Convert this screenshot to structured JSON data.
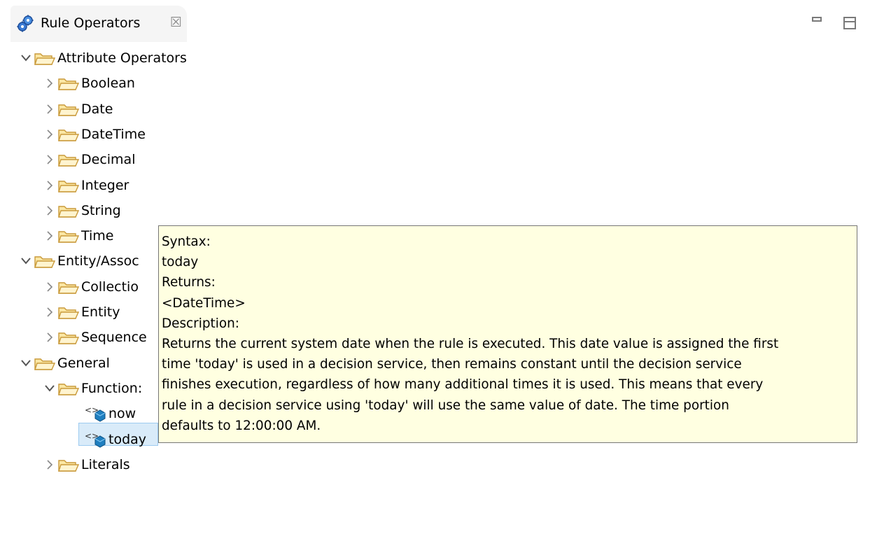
{
  "tab": {
    "title": "Rule Operators",
    "icon": "rule-operators-gears-icon",
    "close_glyph": "☒"
  },
  "tree": [
    {
      "id": "attribute-operators",
      "label": "Attribute Operators",
      "level": 0,
      "expanded": true,
      "kind": "folder"
    },
    {
      "id": "boolean",
      "label": "Boolean",
      "level": 1,
      "expanded": false,
      "kind": "folder"
    },
    {
      "id": "date",
      "label": "Date",
      "level": 1,
      "expanded": false,
      "kind": "folder"
    },
    {
      "id": "datetime",
      "label": "DateTime",
      "level": 1,
      "expanded": false,
      "kind": "folder"
    },
    {
      "id": "decimal",
      "label": "Decimal",
      "level": 1,
      "expanded": false,
      "kind": "folder"
    },
    {
      "id": "integer",
      "label": "Integer",
      "level": 1,
      "expanded": false,
      "kind": "folder"
    },
    {
      "id": "string",
      "label": "String",
      "level": 1,
      "expanded": false,
      "kind": "folder"
    },
    {
      "id": "time",
      "label": "Time",
      "level": 1,
      "expanded": false,
      "kind": "folder"
    },
    {
      "id": "entity-association",
      "label": "Entity/Assoc",
      "level": 0,
      "expanded": true,
      "kind": "folder"
    },
    {
      "id": "collection",
      "label": "Collectio",
      "level": 1,
      "expanded": false,
      "kind": "folder"
    },
    {
      "id": "entity",
      "label": "Entity",
      "level": 1,
      "expanded": false,
      "kind": "folder"
    },
    {
      "id": "sequence",
      "label": "Sequence",
      "level": 1,
      "expanded": false,
      "kind": "folder"
    },
    {
      "id": "general",
      "label": "General",
      "level": 0,
      "expanded": true,
      "kind": "folder"
    },
    {
      "id": "functions",
      "label": "Function:",
      "level": 1,
      "expanded": true,
      "kind": "folder"
    },
    {
      "id": "now",
      "label": "now",
      "level": 2,
      "kind": "function"
    },
    {
      "id": "today",
      "label": "today",
      "level": 2,
      "kind": "function",
      "selected": true
    },
    {
      "id": "literals",
      "label": "Literals",
      "level": 1,
      "expanded": false,
      "kind": "folder"
    }
  ],
  "tooltip": {
    "lines": [
      "Syntax:",
      "today",
      "Returns:",
      "<DateTime>",
      "Description:",
      "Returns the current system date when the rule is executed. This date value is assigned the first",
      "time 'today' is used in a decision service, then remains constant until the decision service",
      "finishes execution, regardless of how many additional times it is used. This means that every",
      "rule in a decision service using 'today' will use the same value of date. The time portion",
      "defaults to 12:00:00 AM."
    ]
  },
  "colors": {
    "tooltip_bg": "#ffffe1",
    "selection_bg": "#d9ebf9",
    "folder_stroke": "#c99a3a",
    "folder_fill": "#fbe7a4"
  }
}
